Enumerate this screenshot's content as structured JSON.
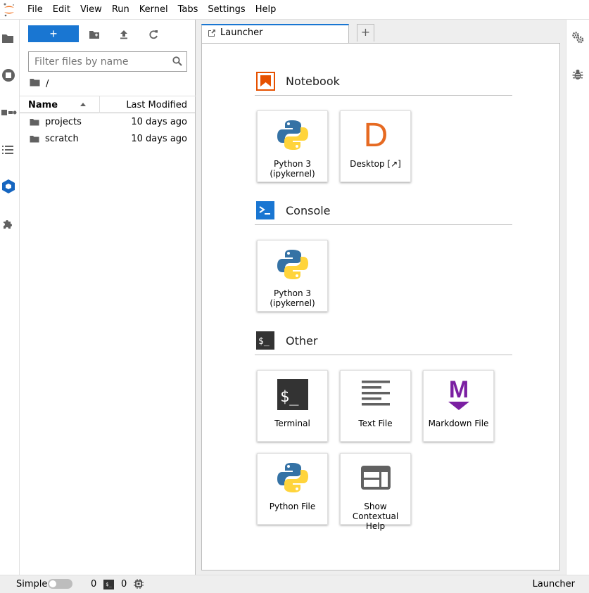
{
  "menubar": {
    "items": [
      "File",
      "Edit",
      "View",
      "Run",
      "Kernel",
      "Tabs",
      "Settings",
      "Help"
    ]
  },
  "file_browser": {
    "new_button_label": "+",
    "filter_placeholder": "Filter files by name",
    "breadcrumb": "/",
    "columns": {
      "name": "Name",
      "modified": "Last Modified"
    },
    "rows": [
      {
        "name": "projects",
        "modified": "10 days ago"
      },
      {
        "name": "scratch",
        "modified": "10 days ago"
      }
    ]
  },
  "tabs": {
    "active_label": "Launcher",
    "add_label": "+"
  },
  "launcher": {
    "sections": [
      {
        "title": "Notebook",
        "icon": "notebook-icon",
        "cards": [
          {
            "label": "Python 3 (ipykernel)",
            "icon": "python-icon"
          },
          {
            "label": "Desktop [↗]",
            "icon": "desktop-d-icon",
            "glyph": "D"
          }
        ]
      },
      {
        "title": "Console",
        "icon": "console-icon",
        "cards": [
          {
            "label": "Python 3 (ipykernel)",
            "icon": "python-icon"
          }
        ]
      },
      {
        "title": "Other",
        "icon": "other-terminal-icon",
        "cards": [
          {
            "label": "Terminal",
            "icon": "terminal-icon"
          },
          {
            "label": "Text File",
            "icon": "text-file-icon"
          },
          {
            "label": "Markdown File",
            "icon": "markdown-icon",
            "glyph": "M"
          },
          {
            "label": "Python File",
            "icon": "python-icon"
          },
          {
            "label": "Show Contextual Help",
            "icon": "contextual-help-icon"
          }
        ]
      }
    ]
  },
  "status_bar": {
    "mode_label": "Simple",
    "kernels_count": "0",
    "terminal_glyph": "$_",
    "terminals_count": "0",
    "right_label": "Launcher"
  },
  "colors": {
    "accent_blue": "#1976d2",
    "notebook_orange": "#e65100",
    "console_blue": "#1976d2",
    "markdown_purple": "#7b1fa2",
    "python_blue": "#3572a5",
    "python_yellow": "#ffd43b"
  }
}
